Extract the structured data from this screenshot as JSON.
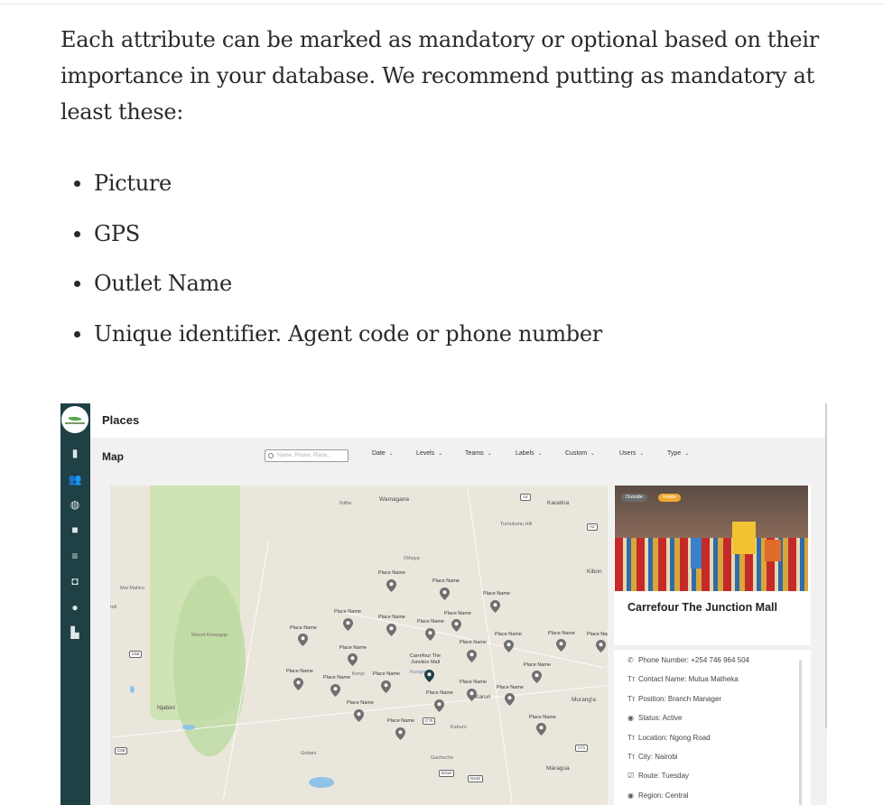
{
  "article": {
    "intro": "Each attribute can be marked as mandatory or optional based on their importance in your database. We recommend putting as mandatory at least these:",
    "bullets": [
      "Picture",
      "GPS",
      "Outlet Name",
      "Unique identifier. Agent code or phone number"
    ]
  },
  "app": {
    "page_title": "Places",
    "section_title": "Map",
    "search_placeholder": "Name, Phone, Place...",
    "filters": [
      "Date",
      "Levels",
      "Teams",
      "Labels",
      "Custom",
      "Users",
      "Type"
    ],
    "sidebar_icons": [
      "bar-chart-icon",
      "users-icon",
      "globe-icon",
      "briefcase-icon",
      "list-icon",
      "camera-icon",
      "location-pin-icon",
      "buildings-icon"
    ],
    "map_labels": {
      "ihithe": "Ihithe",
      "wamagana": "Wamagana",
      "karatina": "Karatina",
      "tumutumu": "Tumutumu Hill",
      "othaya": "Othaya",
      "kiboni": "Kibon",
      "maimahiro": "Mai Mahiro",
      "ndi": "ndi",
      "mount_kinangop": "Mount Kinangop",
      "njabini": "Njabini",
      "kahuro": "Kahuro",
      "karuri": "Karuri",
      "murang": "Murang'a",
      "gachocho": "Gachocho",
      "maragua": "Maragua",
      "getiani": "Getiani",
      "kangema": "Kangema",
      "kenyi": "Kenyi"
    },
    "road_badges": [
      "A2",
      "A2",
      "C69",
      "C70",
      "C68",
      "C71",
      "D418",
      "D418"
    ],
    "pin_label": "Place Name",
    "selected_pin_label": "Carrefour The Junction Mall",
    "card": {
      "tag_outside": "Outside",
      "tag_inside": "Inside",
      "title": "Carrefour The Junction Mall",
      "attributes": [
        {
          "icon": "phone-icon",
          "text": "Phone Number: +254 746 964 504"
        },
        {
          "icon": "text-icon",
          "text": "Contact Name: Mutua Matheka"
        },
        {
          "icon": "text-icon",
          "text": "Position: Branch Manager"
        },
        {
          "icon": "radio-icon",
          "text": "Status: Active"
        },
        {
          "icon": "text-icon",
          "text": "Location: Ngong Road"
        },
        {
          "icon": "text-icon",
          "text": "City: Nairobi"
        },
        {
          "icon": "checkbox-icon",
          "text": "Route: Tuesday"
        },
        {
          "icon": "radio-icon",
          "text": "Region: Central"
        }
      ]
    },
    "colors": {
      "sidebar": "#1f4045",
      "pin": "#6f6f6f",
      "pin_selected": "#1f4045",
      "tag_inside": "#f0a930"
    }
  }
}
